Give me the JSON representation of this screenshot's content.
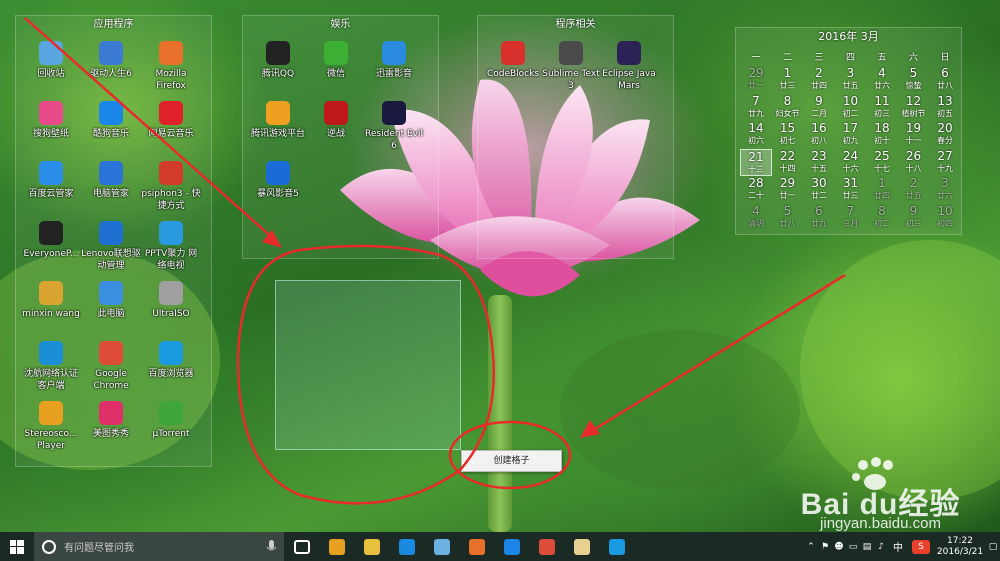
{
  "fences": [
    {
      "title": "应用程序",
      "icons": [
        {
          "label": "回收站",
          "icon": "recycle-bin-icon",
          "color": "#5aa6e0"
        },
        {
          "label": "驱动人生6",
          "icon": "gear-icon",
          "color": "#3b7bd4"
        },
        {
          "label": "Mozilla Firefox",
          "icon": "firefox-icon",
          "color": "#e8702a"
        },
        {
          "label": "搜狗壁纸",
          "icon": "sogou-wallpaper-icon",
          "color": "#e84a8a"
        },
        {
          "label": "酷狗音乐",
          "icon": "kugou-icon",
          "color": "#1a87e8"
        },
        {
          "label": "网易云音乐",
          "icon": "netease-music-icon",
          "color": "#e0212a"
        },
        {
          "label": "百度云管家",
          "icon": "baidu-cloud-icon",
          "color": "#2a8ee8"
        },
        {
          "label": "电脑管家",
          "icon": "shield-icon",
          "color": "#2a74d8"
        },
        {
          "label": "psiphon3 - 快捷方式",
          "icon": "psiphon-icon",
          "color": "#d23a2a"
        },
        {
          "label": "EveryoneP...",
          "icon": "piano-icon",
          "color": "#222222"
        },
        {
          "label": "Lenovo联想驱动管理",
          "icon": "lenovo-icon",
          "color": "#1f6fd0"
        },
        {
          "label": "PPTV聚力 网络电视",
          "icon": "pptv-icon",
          "color": "#2a9ae0"
        },
        {
          "label": "minxin wang",
          "icon": "user-folder-icon",
          "color": "#d9a530"
        },
        {
          "label": "此电脑",
          "icon": "computer-icon",
          "color": "#3a8fe0"
        },
        {
          "label": "UltraISO",
          "icon": "disc-icon",
          "color": "#a0a0a0"
        },
        {
          "label": "沈航网络认证客户端",
          "icon": "network-client-icon",
          "color": "#1a8fd6"
        },
        {
          "label": "Google Chrome",
          "icon": "chrome-icon",
          "color": "#dd4b39"
        },
        {
          "label": "百度浏览器",
          "icon": "baidu-browser-icon",
          "color": "#1a9ae0"
        },
        {
          "label": "Stereosco... Player",
          "icon": "stereoscopic-icon",
          "color": "#e8a020"
        },
        {
          "label": "美图秀秀",
          "icon": "meitu-icon",
          "color": "#e0306a"
        },
        {
          "label": "µTorrent",
          "icon": "utorrent-icon",
          "color": "#3da53a"
        }
      ]
    },
    {
      "title": "娱乐",
      "icons": [
        {
          "label": "腾讯QQ",
          "icon": "qq-penguin-icon",
          "color": "#222222"
        },
        {
          "label": "微信",
          "icon": "wechat-icon",
          "color": "#3cb034"
        },
        {
          "label": "迅雷影音",
          "icon": "xunlei-player-icon",
          "color": "#2a8ae0"
        },
        {
          "label": "腾讯游戏平台",
          "icon": "tencent-games-icon",
          "color": "#f0a020"
        },
        {
          "label": "逆战",
          "icon": "nizhan-icon",
          "color": "#c01818"
        },
        {
          "label": "Resident Evil 6",
          "icon": "resident-evil-icon",
          "color": "#1a1a40"
        },
        {
          "label": "暴风影音5",
          "icon": "baofeng-icon",
          "color": "#1a6ad8"
        }
      ]
    },
    {
      "title": "程序相关",
      "icons": [
        {
          "label": "CodeBlocks",
          "icon": "codeblocks-icon",
          "color": "#d8302a"
        },
        {
          "label": "Sublime Text 3",
          "icon": "sublime-icon",
          "color": "#4a4a4a"
        },
        {
          "label": "Eclipse Java Mars",
          "icon": "eclipse-icon",
          "color": "#2c2255"
        }
      ]
    }
  ],
  "calendar": {
    "title": "2016年 3月",
    "weekdays": [
      "一",
      "二",
      "三",
      "四",
      "五",
      "六",
      "日"
    ],
    "days": [
      {
        "n": "29",
        "l": "廿一",
        "dim": true
      },
      {
        "n": "1",
        "l": "廿三"
      },
      {
        "n": "2",
        "l": "廿四"
      },
      {
        "n": "3",
        "l": "廿五"
      },
      {
        "n": "4",
        "l": "廿六"
      },
      {
        "n": "5",
        "l": "惊蛰"
      },
      {
        "n": "6",
        "l": "廿八"
      },
      {
        "n": "7",
        "l": "廿九"
      },
      {
        "n": "8",
        "l": "妇女节"
      },
      {
        "n": "9",
        "l": "二月"
      },
      {
        "n": "10",
        "l": "初二"
      },
      {
        "n": "11",
        "l": "初三"
      },
      {
        "n": "12",
        "l": "植树节"
      },
      {
        "n": "13",
        "l": "初五"
      },
      {
        "n": "14",
        "l": "初六"
      },
      {
        "n": "15",
        "l": "初七"
      },
      {
        "n": "16",
        "l": "初八"
      },
      {
        "n": "17",
        "l": "初九"
      },
      {
        "n": "18",
        "l": "初十"
      },
      {
        "n": "19",
        "l": "十一"
      },
      {
        "n": "20",
        "l": "春分"
      },
      {
        "n": "21",
        "l": "十三",
        "today": true
      },
      {
        "n": "22",
        "l": "十四"
      },
      {
        "n": "23",
        "l": "十五"
      },
      {
        "n": "24",
        "l": "十六"
      },
      {
        "n": "25",
        "l": "十七"
      },
      {
        "n": "26",
        "l": "十八"
      },
      {
        "n": "27",
        "l": "十九"
      },
      {
        "n": "28",
        "l": "二十"
      },
      {
        "n": "29",
        "l": "廿一"
      },
      {
        "n": "30",
        "l": "廿二"
      },
      {
        "n": "31",
        "l": "廿三"
      },
      {
        "n": "1",
        "l": "廿四",
        "dim": true
      },
      {
        "n": "2",
        "l": "廿五",
        "dim": true
      },
      {
        "n": "3",
        "l": "廿六",
        "dim": true
      },
      {
        "n": "4",
        "l": "清明",
        "dim": true
      },
      {
        "n": "5",
        "l": "廿八",
        "dim": true
      },
      {
        "n": "6",
        "l": "廿九",
        "dim": true
      },
      {
        "n": "7",
        "l": "三月",
        "dim": true
      },
      {
        "n": "8",
        "l": "初二",
        "dim": true
      },
      {
        "n": "9",
        "l": "初三",
        "dim": true
      },
      {
        "n": "10",
        "l": "初四",
        "dim": true
      }
    ]
  },
  "context_menu": {
    "item": "创建格子"
  },
  "watermark": {
    "brand": "Bai du经验",
    "url": "jingyan.baidu.com"
  },
  "taskbar": {
    "search_placeholder": "有问题尽管问我",
    "apps": [
      {
        "name": "task-view-icon",
        "color": "#ffffff"
      },
      {
        "name": "hbuilder-icon",
        "color": "#e8a020"
      },
      {
        "name": "file-explorer-icon",
        "color": "#e8c040"
      },
      {
        "name": "edge-icon",
        "color": "#1a8ae0"
      },
      {
        "name": "notepad-icon",
        "color": "#6ab0e0"
      },
      {
        "name": "firefox-icon",
        "color": "#e8702a"
      },
      {
        "name": "kugou-icon",
        "color": "#1a87e8"
      },
      {
        "name": "chrome-icon",
        "color": "#dd4b39"
      },
      {
        "name": "photo-app-icon",
        "color": "#e8d090"
      },
      {
        "name": "baidu-browser-icon",
        "color": "#1a9ae0"
      }
    ],
    "ime": "中",
    "time": "17:22",
    "date": "2016/3/21"
  }
}
